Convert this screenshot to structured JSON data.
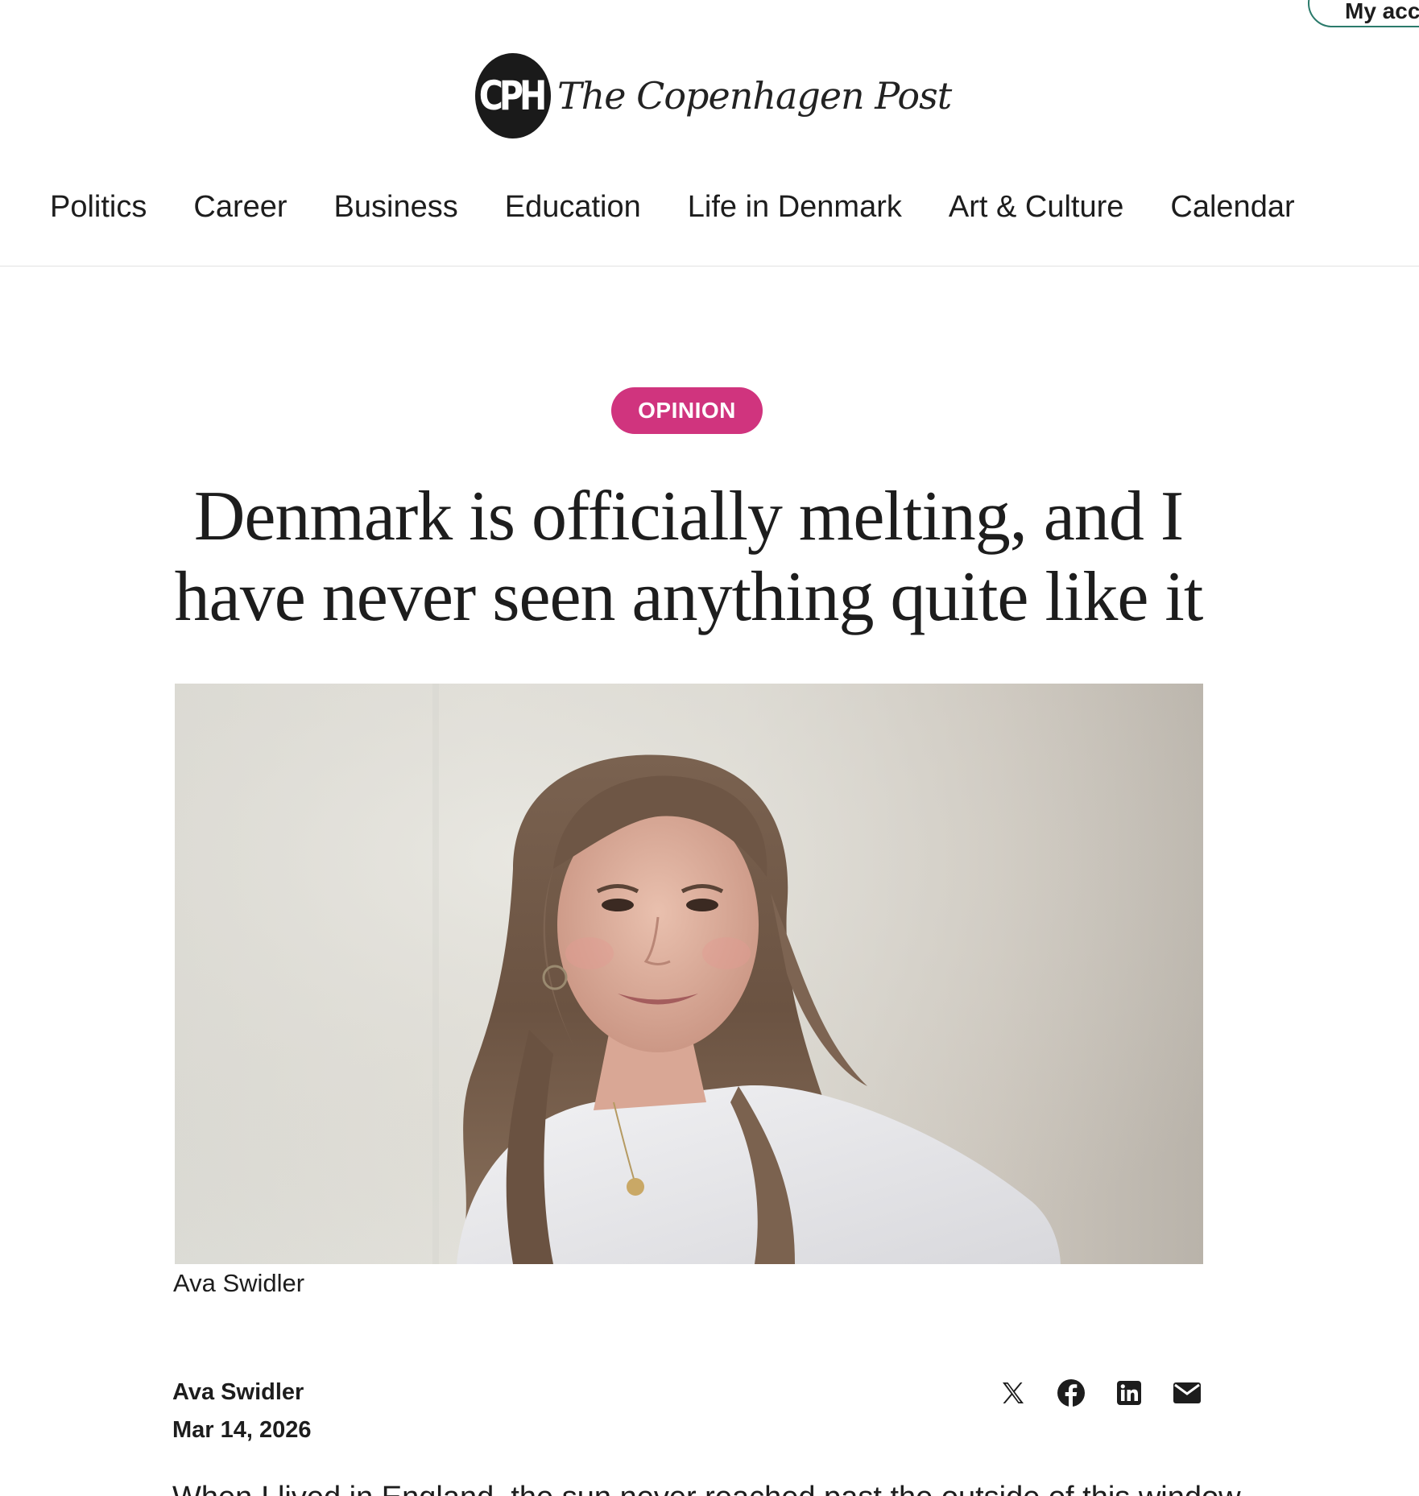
{
  "header": {
    "account_label": "My account",
    "logo_mark": "CPH",
    "logo_name": "The Copenhagen Post"
  },
  "nav": {
    "items": [
      {
        "label": "Politics"
      },
      {
        "label": "Career"
      },
      {
        "label": "Business"
      },
      {
        "label": "Education"
      },
      {
        "label": "Life in Denmark"
      },
      {
        "label": "Art & Culture"
      },
      {
        "label": "Calendar"
      }
    ]
  },
  "article": {
    "category": "OPINION",
    "headline_line1": "Denmark is officially melting, and I",
    "headline_line2": "have never seen anything quite like it",
    "photo_caption": "Ava Swidler",
    "author": "Ava Swidler",
    "date": "Mar 14, 2026",
    "body_start": "When I lived in England, the sun never reached past the outside of this window"
  },
  "share": {
    "icons": [
      "x-icon",
      "facebook-icon",
      "linkedin-icon",
      "email-icon"
    ]
  },
  "colors": {
    "category_pill": "#d0347e",
    "account_border": "#2b7a6b",
    "text": "#1d1d1d"
  }
}
